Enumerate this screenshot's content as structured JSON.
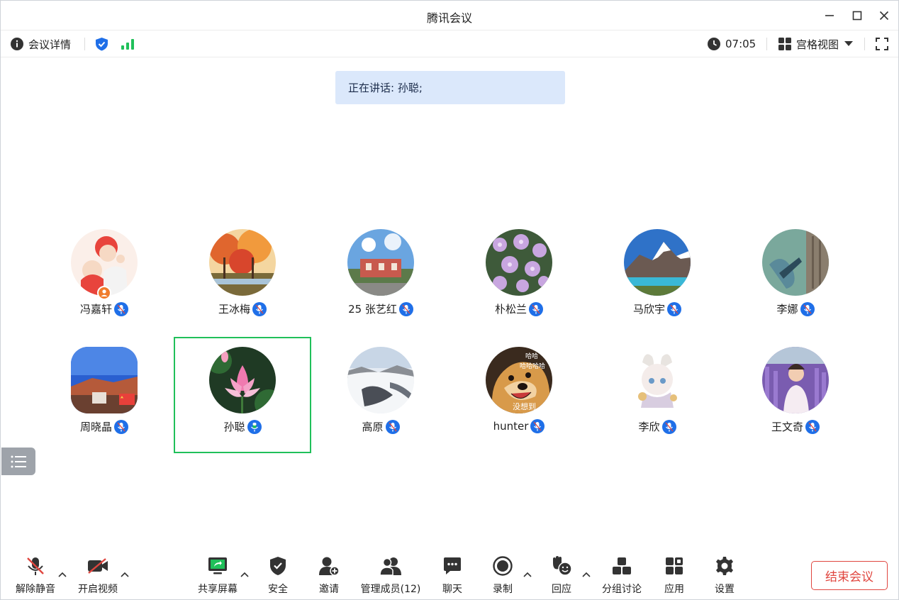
{
  "window": {
    "title": "腾讯会议"
  },
  "infobar": {
    "details_label": "会议详情",
    "timer": "07:05",
    "view_label": "宫格视图"
  },
  "speaking": {
    "text": "正在讲话: 孙聪;"
  },
  "participants": [
    {
      "name": "冯嘉轩",
      "host": true
    },
    {
      "name": "王冰梅"
    },
    {
      "name": "25 张艺红"
    },
    {
      "name": "朴松兰"
    },
    {
      "name": "马欣宇"
    },
    {
      "name": "李娜"
    },
    {
      "name": "周晓晶"
    },
    {
      "name": "孙聪",
      "speaking": true
    },
    {
      "name": "高原"
    },
    {
      "name": "hunter"
    },
    {
      "name": "李欣"
    },
    {
      "name": "王文奇"
    }
  ],
  "avatar_texts": {
    "doge_1": "哈哈",
    "doge_2": "哈哈哈哈",
    "doge_3": "没想到"
  },
  "toolbar": {
    "unmute": "解除静音",
    "video": "开启视频",
    "share": "共享屏幕",
    "security": "安全",
    "invite": "邀请",
    "members": "管理成员(12)",
    "chat": "聊天",
    "record": "录制",
    "react": "回应",
    "breakout": "分组讨论",
    "apps": "应用",
    "settings": "设置",
    "end": "结束会议"
  },
  "colors": {
    "accent": "#1f6fe8",
    "active_border": "#20c05a",
    "end_red": "#e0463f",
    "banner_bg": "#dbe8fb"
  }
}
